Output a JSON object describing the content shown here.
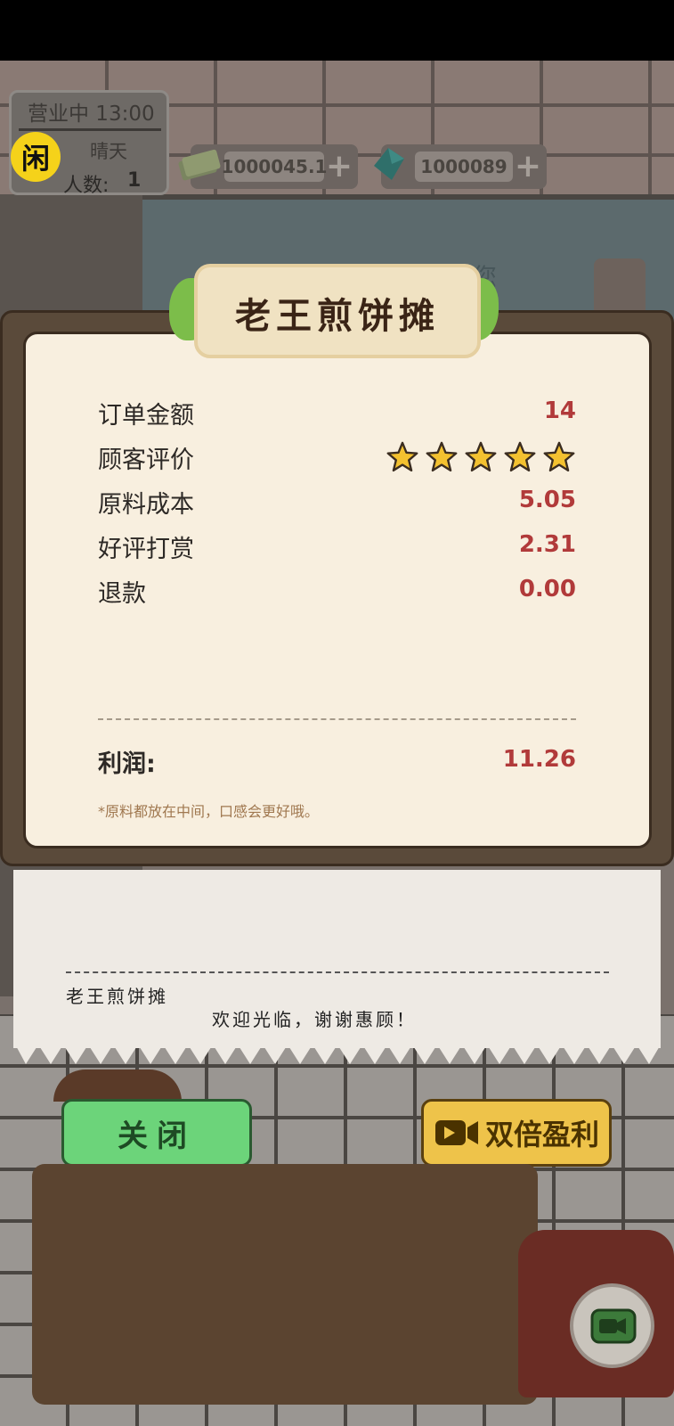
{
  "status": {
    "open_time": "营业中 13:00",
    "weather": "晴天",
    "customers_label": "人数:",
    "customers_value": "1",
    "logo_glyph": "闲"
  },
  "currency": {
    "cash": "1000045.1",
    "gems": "1000089",
    "plus": "+"
  },
  "shop": {
    "title": "老王煎饼摊",
    "bg_sign": "欢迎您"
  },
  "summary": {
    "order_amount_label": "订单金额",
    "order_amount_value": "14",
    "rating_label": "顾客评价",
    "rating_stars": 5,
    "ingredient_cost_label": "原料成本",
    "ingredient_cost_value": "5.05",
    "tip_label": "好评打赏",
    "tip_value": "2.31",
    "refund_label": "退款",
    "refund_value": "0.00",
    "profit_label": "利润:",
    "profit_value": "11.26",
    "note": "*原料都放在中间，口感会更好哦。"
  },
  "receipt": {
    "shop_name": "老王煎饼摊",
    "thanks": "欢迎光临，谢谢惠顾！"
  },
  "buttons": {
    "close": "关闭",
    "double_profit": "双倍盈利"
  },
  "colors": {
    "value_red": "#b13a3a",
    "close_green": "#6cd47a",
    "double_yellow": "#eec34a",
    "star_yellow": "#f3c130"
  }
}
